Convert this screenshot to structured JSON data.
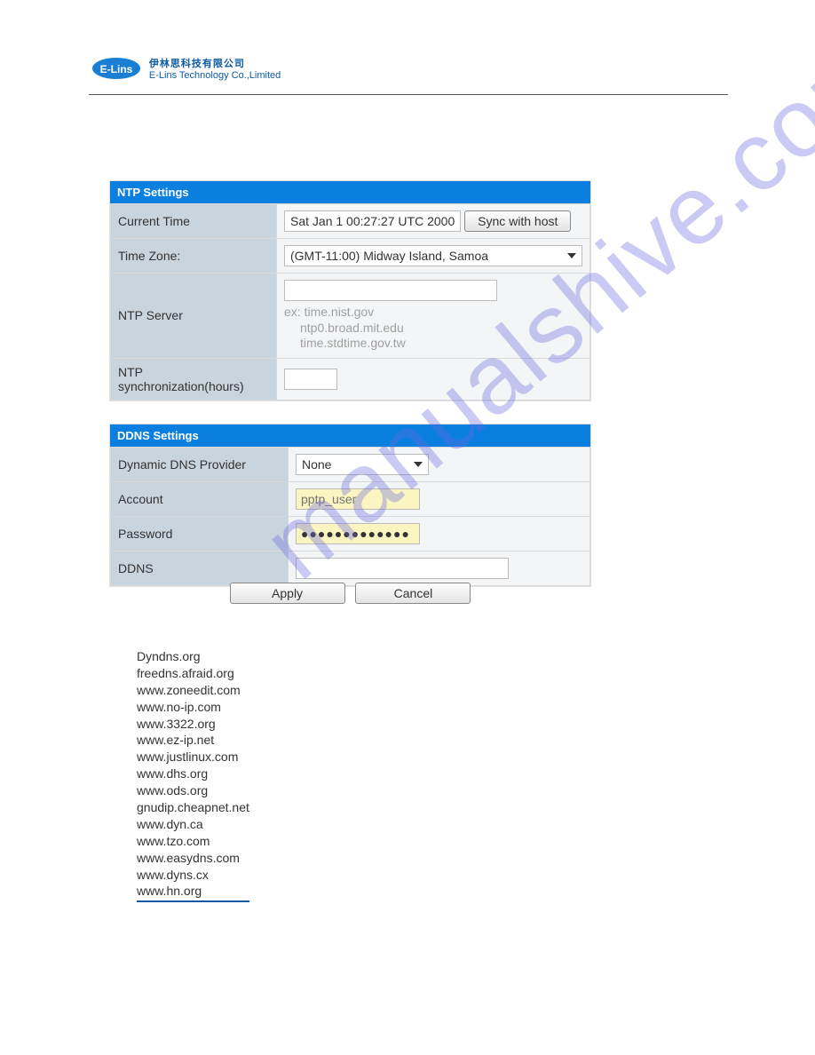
{
  "logo": {
    "badge_text": "E-Lins",
    "cn": "伊林思科技有限公司",
    "en": "E-Lins Technology Co.,Limited"
  },
  "watermark_text": "manualshive.com",
  "ntp": {
    "section_title": "NTP Settings",
    "current_time_label": "Current Time",
    "current_time_value": "Sat Jan  1 00:27:27 UTC 2000",
    "sync_button": "Sync with host",
    "timezone_label": "Time Zone:",
    "timezone_value": "(GMT-11:00) Midway Island, Samoa",
    "server_label": "NTP Server",
    "server_value": "",
    "server_hint_prefix": "ex: time.nist.gov",
    "server_hint_line2": "ntp0.broad.mit.edu",
    "server_hint_line3": "time.stdtime.gov.tw",
    "sync_hours_label": "NTP synchronization(hours)",
    "sync_hours_value": ""
  },
  "ddns": {
    "section_title": "DDNS Settings",
    "provider_label": "Dynamic DNS Provider",
    "provider_value": "None",
    "account_label": "Account",
    "account_value": "",
    "account_placeholder": "pptp_user",
    "password_label": "Password",
    "password_value": "●●●●●●●●●●●●●",
    "ddns_label": "DDNS",
    "ddns_value": ""
  },
  "buttons": {
    "apply": "Apply",
    "cancel": "Cancel"
  },
  "provider_list": [
    "Dyndns.org",
    "freedns.afraid.org",
    "www.zoneedit.com",
    "www.no-ip.com",
    "www.3322.org",
    "www.ez-ip.net",
    "www.justlinux.com",
    "www.dhs.org",
    "www.ods.org",
    "gnudip.cheapnet.net",
    "www.dyn.ca",
    "www.tzo.com",
    "www.easydns.com",
    "www.dyns.cx",
    "www.hn.org"
  ]
}
